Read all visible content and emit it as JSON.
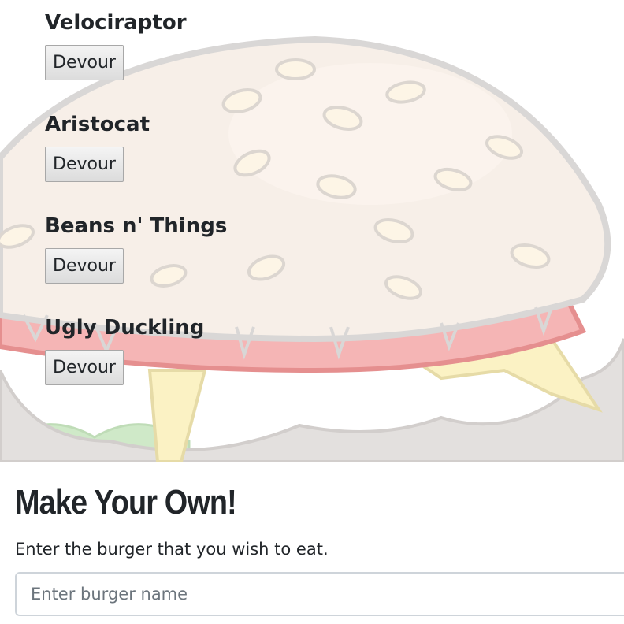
{
  "burgers": [
    {
      "name": "Velociraptor",
      "button_label": "Devour"
    },
    {
      "name": "Aristocat",
      "button_label": "Devour"
    },
    {
      "name": "Beans n' Things",
      "button_label": "Devour"
    },
    {
      "name": "Ugly Duckling",
      "button_label": "Devour"
    }
  ],
  "form": {
    "heading": "Make Your Own!",
    "label": "Enter the burger that you wish to eat.",
    "input_placeholder": "Enter burger name",
    "input_value": ""
  },
  "colors": {
    "bun": "#f7efe8",
    "outline": "#d9d7d6",
    "tomato": "#f4b4b4",
    "cheese": "#fbf3c6",
    "lettuce": "#cdebc6",
    "patty": "#dedcda"
  },
  "background_icon": "burger-illustration"
}
